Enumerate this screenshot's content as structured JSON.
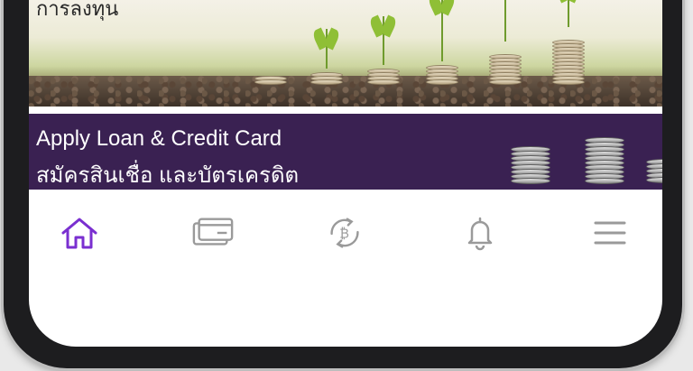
{
  "banner_top": {
    "title": "การลงทุน"
  },
  "banner_loan": {
    "title_en": "Apply Loan & Credit Card",
    "title_th": "สมัครสินเชื่อ และบัตรเครดิต"
  },
  "nav": {
    "items": [
      {
        "icon": "home-icon",
        "active": true
      },
      {
        "icon": "card-icon",
        "active": false
      },
      {
        "icon": "bitcoin-exchange-icon",
        "active": false
      },
      {
        "icon": "bell-icon",
        "active": false
      },
      {
        "icon": "menu-icon",
        "active": false
      }
    ],
    "active_color": "#7a2fd0",
    "inactive_color": "#9a9a9a"
  }
}
